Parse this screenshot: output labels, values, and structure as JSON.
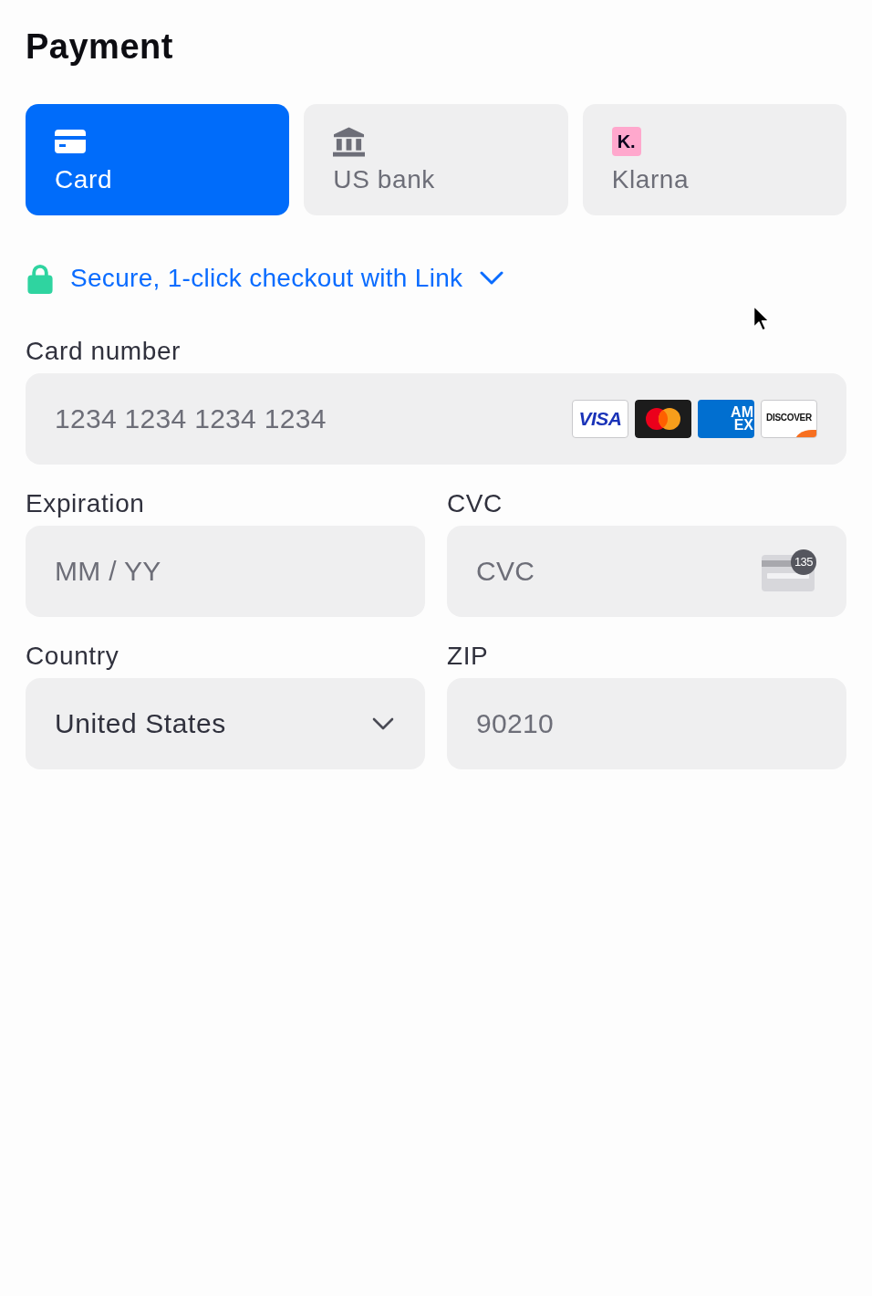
{
  "title": "Payment",
  "tabs": [
    {
      "kind": "card",
      "label": "Card",
      "selected": true
    },
    {
      "kind": "bank",
      "label": "US bank",
      "selected": false
    },
    {
      "kind": "klarna",
      "badge": "K.",
      "label": "Klarna",
      "selected": false
    }
  ],
  "link_banner": {
    "text": "Secure, 1-click checkout with Link",
    "expanded": false
  },
  "fields": [
    {
      "kind": "card_number",
      "label": "Card number",
      "placeholder": "1234 1234 1234 1234",
      "brands": [
        {
          "kind": "visa",
          "label": "VISA"
        },
        {
          "kind": "mastercard"
        },
        {
          "kind": "amex",
          "lines": [
            "AM",
            "EX"
          ]
        },
        {
          "kind": "discover",
          "label": "DISCOVER"
        }
      ]
    },
    {
      "kind": "text",
      "label": "Expiration",
      "placeholder": "MM / YY"
    },
    {
      "kind": "cvc",
      "label": "CVC",
      "placeholder": "CVC",
      "hint_number": "135"
    },
    {
      "kind": "select",
      "label": "Country",
      "value": "United States"
    },
    {
      "kind": "text",
      "label": "ZIP",
      "placeholder": "90210"
    }
  ]
}
